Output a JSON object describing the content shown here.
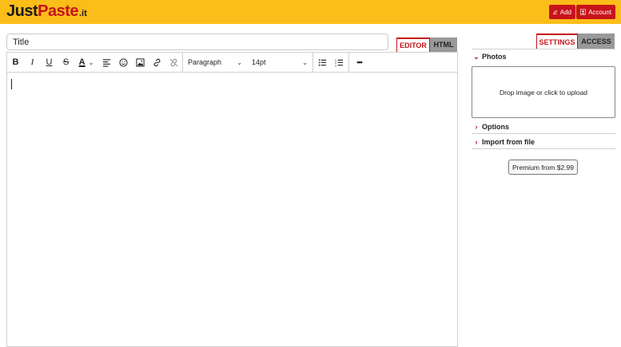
{
  "header": {
    "logo_main": "Just",
    "logo_paste": "Paste",
    "logo_tld": ".it",
    "add_label": "Add",
    "account_label": "Account"
  },
  "editor": {
    "title_placeholder": "Title",
    "tab_editor": "EDITOR",
    "tab_html": "HTML",
    "toolbar": {
      "bold": "B",
      "italic": "I",
      "underline": "U",
      "strike": "S",
      "font_color": "A",
      "block_format": "Paragraph",
      "font_size": "14pt",
      "more": "•••"
    }
  },
  "sidebar": {
    "tab_settings": "SETTINGS",
    "tab_access": "ACCESS",
    "photos_label": "Photos",
    "dropzone_text": "Drop image or click to upload",
    "options_label": "Options",
    "import_label": "Import from file",
    "premium_label": "Premium from $2.99"
  },
  "colors": {
    "header_bg": "#fbbd19",
    "accent": "#c8141b",
    "inactive_tab": "#999999"
  }
}
